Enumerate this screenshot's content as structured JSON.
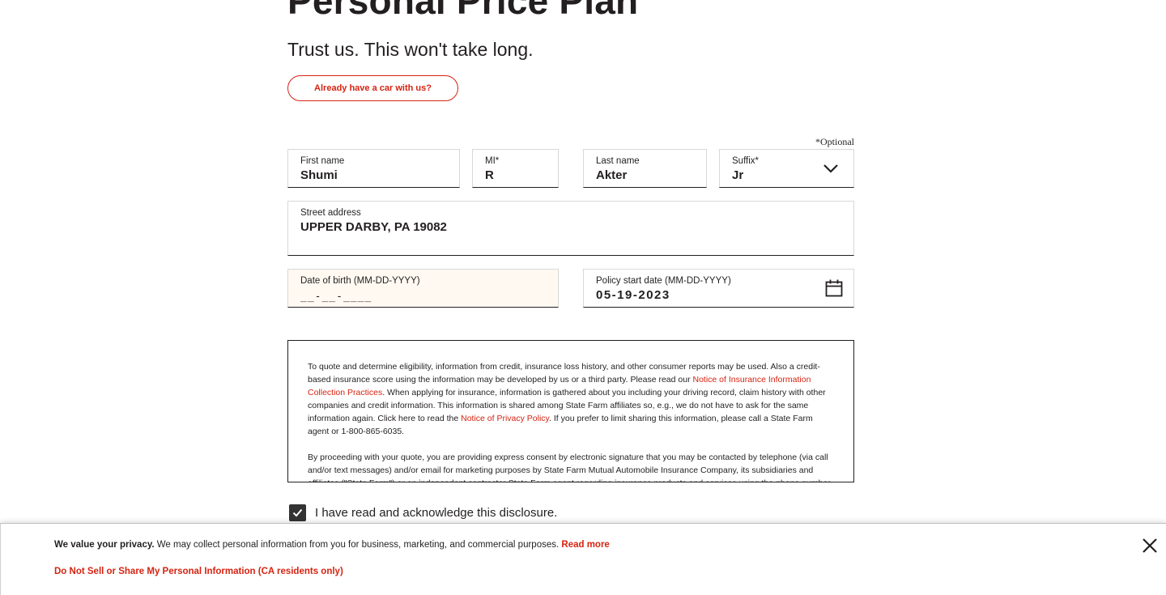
{
  "header": {
    "title": "Personal Price Plan",
    "title_mark": "™",
    "subtitle": "Trust us. This won't take long.",
    "existing_customer_button": "Already have a car with us?"
  },
  "form": {
    "optional_note": "*Optional",
    "first_name": {
      "label": "First name",
      "value": "Shumi"
    },
    "middle_initial": {
      "label": "MI*",
      "value": "R"
    },
    "last_name": {
      "label": "Last name",
      "value": "Akter"
    },
    "suffix": {
      "label": "Suffix*",
      "value": "Jr"
    },
    "street_address": {
      "label": "Street address",
      "value": "UPPER DARBY, PA 19082"
    },
    "date_of_birth": {
      "label": "Date of birth (MM-DD-YYYY)",
      "value": "__-__-____"
    },
    "policy_start_date": {
      "label": "Policy start date (MM-DD-YYYY)",
      "value": "05-19-2023"
    }
  },
  "disclosure": {
    "p1_part1": "To quote and determine eligibility, information from credit, insurance loss history, and other consumer reports may be used. Also a credit-based insurance score using the information may be developed by us or a third party. Please read our ",
    "p1_link1": "Notice of Insurance Information Collection Practices",
    "p1_part2": ". When applying for insurance, information is gathered about you including your driving record, claim history with other companies and credit information. This information is shared among State Farm affiliates so, e.g., we do not have to ask for the same information again. Click here to read the ",
    "p1_link2": "Notice of Privacy Policy",
    "p1_part3": ". If you prefer to limit sharing this information, please call a State Farm agent or 1-800-865-6035.",
    "p2": "By proceeding with your quote, you are providing express consent by electronic signature that you may be contacted by telephone (via call and/or text messages) and/or email for marketing purposes by State Farm Mutual Automobile Insurance Company, its subsidiaries and affiliates (\"State Farm\") or an independent contractor State Farm agent regarding insurance products and services using the phone number and email address you have provided."
  },
  "acknowledge": {
    "label": "I have read and acknowledge this disclosure.",
    "checked": true
  },
  "privacy_banner": {
    "bold_text": "We value your privacy.",
    "text": " We may collect personal information from you for business, marketing, and commercial purposes. ",
    "read_more": "Read more",
    "dns_link": "Do Not Sell or Share My Personal Information (CA residents only)"
  },
  "icons": {
    "suffix_dropdown": "chevron-down-icon",
    "calendar": "calendar-icon",
    "checkbox": "checkmark-icon",
    "banner_close": "close-icon"
  },
  "colors": {
    "accent": "#d62311",
    "text": "#231f20",
    "dob_field_bg": "#fff9f1",
    "checkbox_bg": "#333333"
  }
}
